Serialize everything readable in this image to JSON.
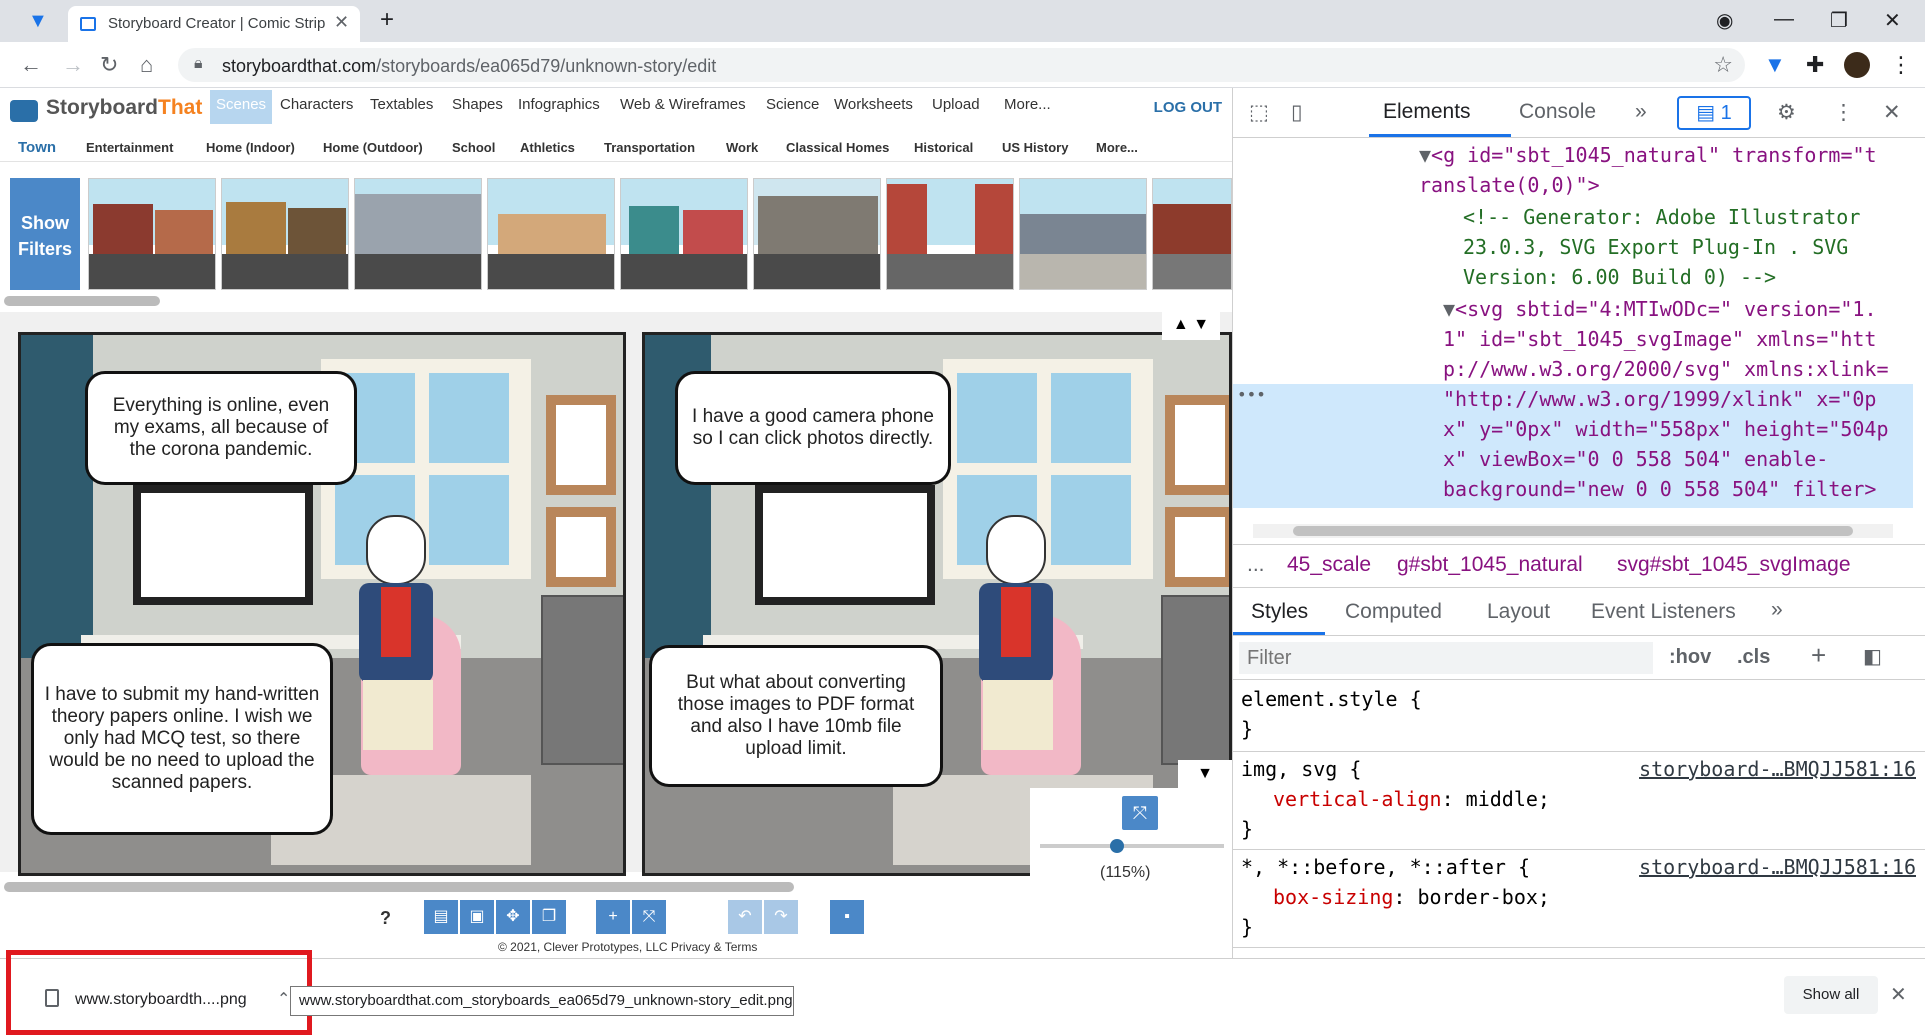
{
  "browser": {
    "tab_title": "Storyboard Creator | Comic Strip",
    "url_host": "storyboardthat.com",
    "url_path": "/storyboards/ea065d79/unknown-story/edit"
  },
  "site": {
    "brand_prefix": "Storyboard",
    "brand_suffix": "That",
    "nav": [
      "Scenes",
      "Characters",
      "Textables",
      "Shapes",
      "Infographics",
      "Web & Wireframes",
      "Science",
      "Worksheets",
      "Upload",
      "More..."
    ],
    "logout": "LOG OUT",
    "categories": [
      "Town",
      "Entertainment",
      "Home (Indoor)",
      "Home (Outdoor)",
      "School",
      "Athletics",
      "Transportation",
      "Work",
      "Classical Homes",
      "Historical",
      "US History",
      "More..."
    ],
    "show_filters": "Show Filters"
  },
  "panels": [
    {
      "top_bubble": "Everything is online, even my exams, all because of the corona pandemic.",
      "bottom_bubble": "I have to submit my hand-written theory papers online. I wish we only had MCQ test, so there would be no need to upload the scanned papers."
    },
    {
      "top_bubble": "I have a good camera phone so I can click photos directly.",
      "bottom_bubble": "But what about converting those images to PDF format and also I have 10mb file upload limit."
    }
  ],
  "zoom": {
    "label": "(115%)",
    "value_percent": 115
  },
  "footer": {
    "help": "?",
    "copyright": "© 2021, Clever Prototypes, LLC Privacy & Terms"
  },
  "devtools": {
    "tabs": [
      "Elements",
      "Console"
    ],
    "issues_count": "1",
    "code_lines": [
      "<g id=\"sbt_1045_natural\" transform=\"t",
      "ranslate(0,0)\">",
      "<!-- Generator: Adobe Illustrator",
      "23.0.3, SVG Export Plug-In . SVG",
      "Version: 6.00 Build 0) -->",
      "<svg sbtid=\"4:MTIwODc=\" version=\"1.",
      "1\" id=\"sbt_1045_svgImage\" xmlns=\"htt",
      "p://www.w3.org/2000/svg\" xmlns:xlink=",
      "\"http://www.w3.org/1999/xlink\" x=\"0p",
      "x\" y=\"0px\" width=\"558px\" height=\"504p",
      "x\" viewBox=\"0 0 558 504\" enable-",
      "background=\"new 0 0 558 504\" filter>"
    ],
    "breadcrumbs": [
      "...",
      "45_scale",
      "g#sbt_1045_natural",
      "svg#sbt_1045_svgImage"
    ],
    "style_tabs": [
      "Styles",
      "Computed",
      "Layout",
      "Event Listeners"
    ],
    "filter_placeholder": "Filter",
    "hov": ":hov",
    "cls": ".cls",
    "rules": [
      {
        "selector": "element.style {",
        "props": [],
        "close": "}",
        "source": ""
      },
      {
        "selector": "img, svg {",
        "props": [
          {
            "name": "vertical-align",
            "value": "middle;"
          }
        ],
        "close": "}",
        "source": "storyboard-…BMQJJ581:16"
      },
      {
        "selector": "*, *::before, *::after {",
        "props": [
          {
            "name": "box-sizing",
            "value": "border-box;"
          }
        ],
        "close": "}",
        "source": "storyboard-…BMQJJ581:16"
      }
    ]
  },
  "downloads": {
    "item_name": "www.storyboardth....png",
    "tooltip": "www.storyboardthat.com_storyboards_ea065d79_unknown-story_edit.png",
    "show_all": "Show all"
  }
}
